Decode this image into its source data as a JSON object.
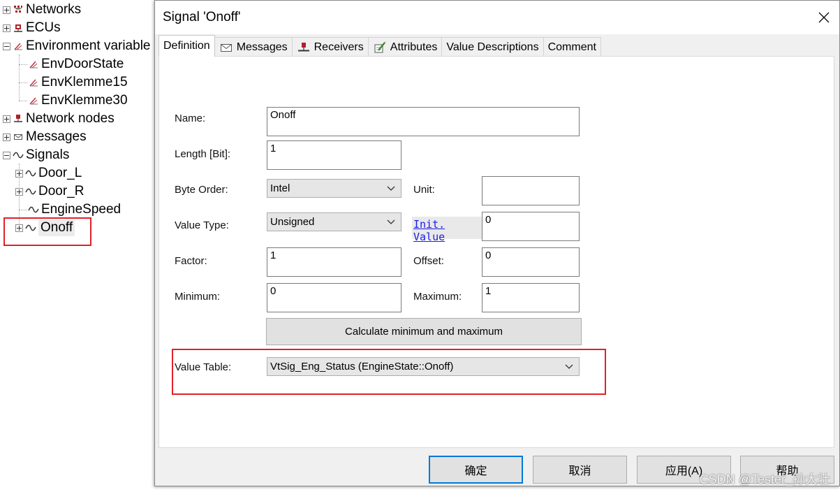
{
  "tree": {
    "items": [
      {
        "label": "Networks",
        "icon": "networks-icon",
        "toggle": "plus"
      },
      {
        "label": "ECUs",
        "icon": "ecu-icon",
        "toggle": "plus"
      },
      {
        "label": "Environment variable",
        "icon": "environment-variable-icon",
        "toggle": "minus"
      },
      {
        "label": "EnvDoorState",
        "icon": "environment-variable-icon",
        "toggle": "none"
      },
      {
        "label": "EnvKlemme15",
        "icon": "environment-variable-icon",
        "toggle": "none"
      },
      {
        "label": "EnvKlemme30",
        "icon": "environment-variable-icon",
        "toggle": "none"
      },
      {
        "label": "Network nodes",
        "icon": "network-node-icon",
        "toggle": "plus"
      },
      {
        "label": "Messages",
        "icon": "message-icon",
        "toggle": "plus"
      },
      {
        "label": "Signals",
        "icon": "signal-icon",
        "toggle": "minus"
      },
      {
        "label": "Door_L",
        "icon": "signal-icon",
        "toggle": "plus"
      },
      {
        "label": "Door_R",
        "icon": "signal-icon",
        "toggle": "plus"
      },
      {
        "label": "EngineSpeed",
        "icon": "signal-icon",
        "toggle": "none"
      },
      {
        "label": "Onoff",
        "icon": "signal-icon",
        "toggle": "plus",
        "selected": true
      }
    ]
  },
  "dialog": {
    "title": "Signal 'Onoff'",
    "tabs": [
      {
        "label": "Definition",
        "icon": ""
      },
      {
        "label": "Messages",
        "icon": "envelope-icon"
      },
      {
        "label": "Receivers",
        "icon": "receiver-node-icon"
      },
      {
        "label": "Attributes",
        "icon": "attributes-icon"
      },
      {
        "label": "Value Descriptions",
        "icon": ""
      },
      {
        "label": "Comment",
        "icon": ""
      }
    ],
    "form": {
      "name_label": "Name:",
      "name_value": "Onoff",
      "length_label": "Length [Bit]:",
      "length_value": "1",
      "byte_order_label": "Byte Order:",
      "byte_order_value": "Intel",
      "unit_label": "Unit:",
      "unit_value": "",
      "value_type_label": "Value Type:",
      "value_type_value": "Unsigned",
      "init_value_label": "Init. Value",
      "init_value_value": "0",
      "factor_label": "Factor:",
      "factor_value": "1",
      "offset_label": "Offset:",
      "offset_value": "0",
      "minimum_label": "Minimum:",
      "minimum_value": "0",
      "maximum_label": "Maximum:",
      "maximum_value": "1",
      "calc_button_label": "Calculate minimum and maximum",
      "value_table_label": "Value Table:",
      "value_table_value": "VtSig_Eng_Status (EngineState::Onoff)"
    },
    "buttons": {
      "ok": "确定",
      "cancel": "取消",
      "apply": "应用(A)",
      "help": "帮助"
    }
  },
  "watermark": "CSDN @Tester_孙大壮",
  "colors": {
    "highlight_red": "#e0202a",
    "link_blue": "#1a1aee",
    "focus_blue": "#0078d7"
  }
}
